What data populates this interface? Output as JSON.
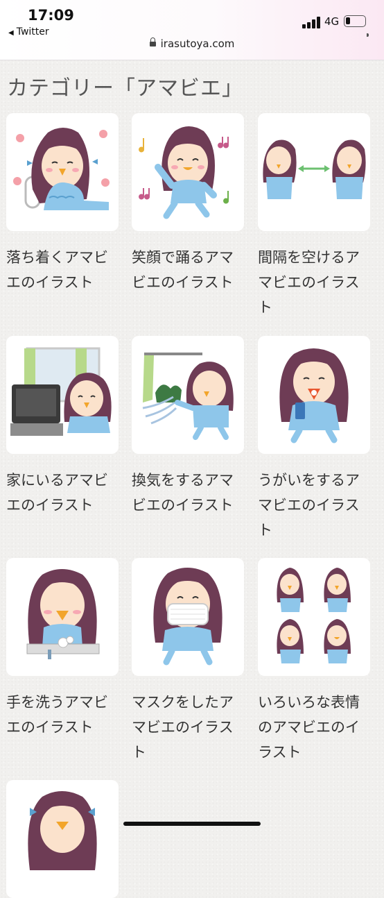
{
  "status": {
    "time": "17:09",
    "back_app": "Twitter",
    "network": "4G"
  },
  "address_bar": {
    "url": "irasutoya.com"
  },
  "page": {
    "title": "カテゴリー「アマビエ」"
  },
  "items": [
    {
      "caption": "落ち着くアマビエのイラスト"
    },
    {
      "caption": "笑顔で踊るアマビエのイラスト"
    },
    {
      "caption": "間隔を空けるアマビエのイラスト"
    },
    {
      "caption": "家にいるアマビエのイラスト"
    },
    {
      "caption": "換気をするアマビエのイラスト"
    },
    {
      "caption": "うがいをするアマビエのイラスト"
    },
    {
      "caption": "手を洗うアマビエのイラスト"
    },
    {
      "caption": "マスクをしたアマビエのイラスト"
    },
    {
      "caption": "いろいろな表情のアマビエのイラスト"
    }
  ],
  "colors": {
    "hair": "#6e3c55",
    "body": "#8ec6ea",
    "skin": "#fbe2cc",
    "beak": "#f2a52b",
    "text": "#333333"
  }
}
